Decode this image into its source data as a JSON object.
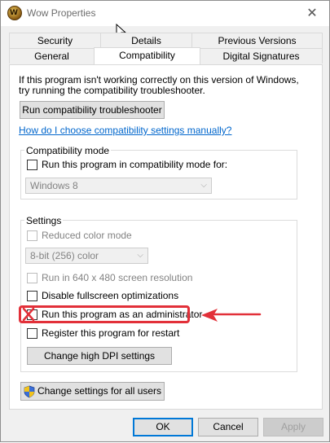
{
  "window": {
    "title": "Wow Properties",
    "close_glyph": "✕"
  },
  "tabs": {
    "row1": [
      "Security",
      "Details",
      "Previous Versions"
    ],
    "row2": [
      "General",
      "Compatibility",
      "Digital Signatures"
    ],
    "active": "Compatibility"
  },
  "intro": {
    "line1": "If this program isn't working correctly on this version of Windows,",
    "line2": "try running the compatibility troubleshooter."
  },
  "troubleshooter_button": "Run compatibility troubleshooter",
  "manual_link": "How do I choose compatibility settings manually?",
  "compat_mode": {
    "label": "Compatibility mode",
    "checkbox_label": "Run this program in compatibility mode for:",
    "checked": false,
    "selected_os": "Windows 8"
  },
  "settings": {
    "label": "Settings",
    "reduced_color": {
      "label": "Reduced color mode",
      "checked": false,
      "enabled": false
    },
    "color_select": "8-bit (256) color",
    "run_640": {
      "label": "Run in 640 x 480 screen resolution",
      "checked": false,
      "enabled": false
    },
    "disable_fullscreen": {
      "label": "Disable fullscreen optimizations",
      "checked": false
    },
    "run_as_admin": {
      "label": "Run this program as an administrator",
      "checked": false
    },
    "register_restart": {
      "label": "Register this program for restart",
      "checked": false
    },
    "dpi_button": "Change high DPI settings"
  },
  "all_users_button": "Change settings for all users",
  "footer": {
    "ok": "OK",
    "cancel": "Cancel",
    "apply": "Apply"
  },
  "annotation": {
    "color": "#e23039"
  },
  "icons": [
    "wow-app-icon",
    "close-icon",
    "mouse-cursor-icon",
    "shield-icon",
    "chevron-down-icon",
    "red-arrow-icon",
    "red-x-mark-icon"
  ]
}
